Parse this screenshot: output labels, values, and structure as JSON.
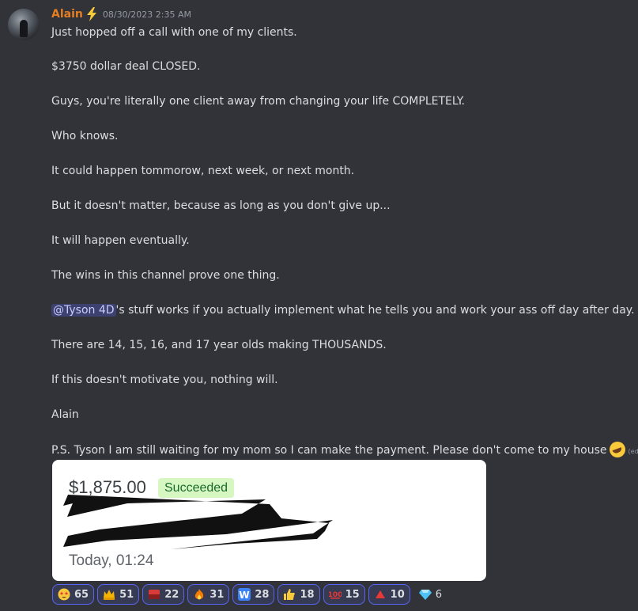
{
  "message": {
    "username": "Alain",
    "timestamp": "08/30/2023 2:35 AM",
    "lines": [
      "Just hopped off a call with one of my clients.",
      "$3750 dollar deal CLOSED.",
      "Guys, you're literally one client away from changing your life COMPLETELY.",
      "Who knows.",
      "It could happen tommorow, next week, or next month.",
      "But it doesn't matter, because as long as you don't give up...",
      "It will happen eventually.",
      "The wins in this channel prove one thing.",
      "There are 14, 15, 16, and 17 year olds making THOUSANDS.",
      "If this doesn't motivate you, nothing will.",
      "Alain",
      "P.S. Tyson I am still waiting for my mom so I can make the payment. Please don't come to my house"
    ],
    "mention": "@Tyson 4D",
    "mention_suffix": "'s stuff works if you actually implement what he tells you and work your ass off day after day.",
    "edited": "(edited)"
  },
  "payment_card": {
    "amount": "$1,875.00",
    "status": "Succeeded",
    "time": "Today, 01:24"
  },
  "reactions": [
    {
      "icon": "star-struck-icon",
      "count": "65",
      "color": "#f9c93c"
    },
    {
      "icon": "crown-icon",
      "count": "51",
      "color": "#f4b400"
    },
    {
      "icon": "flag-icon",
      "count": "22",
      "color": "#d93a3a"
    },
    {
      "icon": "fire-icon",
      "count": "31",
      "color": "#f57c00"
    },
    {
      "icon": "w-letter-icon",
      "count": "28",
      "color": "#3b82f6"
    },
    {
      "icon": "thumbs-up-icon",
      "count": "18",
      "color": "#f9c93c"
    },
    {
      "icon": "hundred-icon",
      "count": "15",
      "color": "#e53935"
    },
    {
      "icon": "up-triangle-icon",
      "count": "10",
      "color": "#e53935"
    },
    {
      "icon": "gem-icon",
      "count": "6",
      "color": "#4fc3f7"
    }
  ]
}
